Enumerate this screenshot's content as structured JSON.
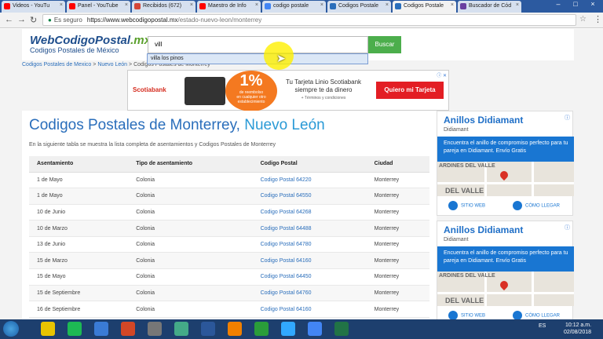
{
  "browser": {
    "tabs": [
      {
        "label": "Videos - YouTu",
        "color": "#ff0000",
        "active": false
      },
      {
        "label": "Panel - YouTube",
        "color": "#ff0000",
        "active": false
      },
      {
        "label": "Recibidos (672)",
        "color": "#d44638",
        "active": false
      },
      {
        "label": "Maestro de Info",
        "color": "#ff0000",
        "active": false
      },
      {
        "label": "codigo postale",
        "color": "#4285f4",
        "active": false
      },
      {
        "label": "Codigos Postale",
        "color": "#2a6ebb",
        "active": false
      },
      {
        "label": "Codigos Postale",
        "color": "#2a6ebb",
        "active": true
      },
      {
        "label": "Buscador de Cód",
        "color": "#6a3fa0",
        "active": false
      }
    ],
    "secure_label": "Es seguro",
    "url_host": "https://www.webcodigopostal.mx",
    "url_path": "/estado-nuevo-leon/monterrey"
  },
  "site": {
    "logo_main": "WebCodigoPostal",
    "logo_tld": ".mx",
    "logo_sub": "Codigos Postales de México",
    "search_value": "vill",
    "search_button": "Buscar",
    "suggestion": "villa los pinos"
  },
  "breadcrumb": {
    "item1": "Codigos Postales de Mexico",
    "sep": ">",
    "item2": "Nuevo León",
    "item3": "Codigos Postales de Monterrey"
  },
  "banner_ad": {
    "brand": "Scotiabank",
    "percent": "1%",
    "percent_label": "de reembolso",
    "percent_note": "en cualquier otro establecimiento",
    "headline": "Tu Tarjeta Linio Scotiabank siempre te da dinero",
    "terms": "+ Términos y condiciones",
    "cta": "Quiero mi Tarjeta",
    "close": "ⓘ ✕"
  },
  "main": {
    "title_city": "Codigos Postales de Monterrey,",
    "title_state": "Nuevo León",
    "description": "En la siguiente tabla se muestra la lista completa de asentamientos y Codigos Postales de Monterrey",
    "headers": [
      "Asentamiento",
      "Tipo de asentamiento",
      "Codigo Postal",
      "Ciudad"
    ],
    "rows": [
      [
        "1 de Mayo",
        "Colonia",
        "Codigo Postal 64220",
        "Monterrey"
      ],
      [
        "1 de Mayo",
        "Colonia",
        "Codigo Postal 64550",
        "Monterrey"
      ],
      [
        "10 de Junio",
        "Colonia",
        "Codigo Postal 64268",
        "Monterrey"
      ],
      [
        "10 de Marzo",
        "Colonia",
        "Codigo Postal 64488",
        "Monterrey"
      ],
      [
        "13 de Junio",
        "Colonia",
        "Codigo Postal 64780",
        "Monterrey"
      ],
      [
        "15 de Marzo",
        "Colonia",
        "Codigo Postal 64160",
        "Monterrey"
      ],
      [
        "15 de Mayo",
        "Colonia",
        "Codigo Postal 64450",
        "Monterrey"
      ],
      [
        "15 de Septiembre",
        "Colonia",
        "Codigo Postal 64760",
        "Monterrey"
      ],
      [
        "16 de Septiembre",
        "Colonia",
        "Codigo Postal 64160",
        "Monterrey"
      ]
    ]
  },
  "side_ads": [
    {
      "title": "Anillos Didiamant",
      "subtitle": "Didiamant",
      "body": "Encuentra el anillo de compromiso perfecto para tu pareja en Didiamant. Envío Gratis",
      "map_label1": "ARDINES DEL VALLE",
      "map_label2": "DEL VALLE",
      "btn1": "SITIO WEB",
      "btn2": "CÓMO LLEGAR"
    },
    {
      "title": "Anillos Didiamant",
      "subtitle": "Didiamant",
      "body": "Encuentra el anillo de compromiso perfecto para tu pareja en Didiamant. Envío Gratis",
      "map_label1": "ARDINES DEL VALLE",
      "map_label2": "DEL VALLE",
      "btn1": "SITIO WEB",
      "btn2": "CÓMO LLEGAR"
    }
  ],
  "taskbar": {
    "language": "ES",
    "time": "10:12 a.m.",
    "date": "02/08/2018",
    "icons": [
      "paint-icon",
      "spotify-icon",
      "app-icon",
      "powerpoint-icon",
      "pictures-icon",
      "app2-icon",
      "word-icon",
      "vlc-icon",
      "camtasia-icon",
      "photoshop-icon",
      "chrome-icon",
      "excel-icon"
    ]
  }
}
